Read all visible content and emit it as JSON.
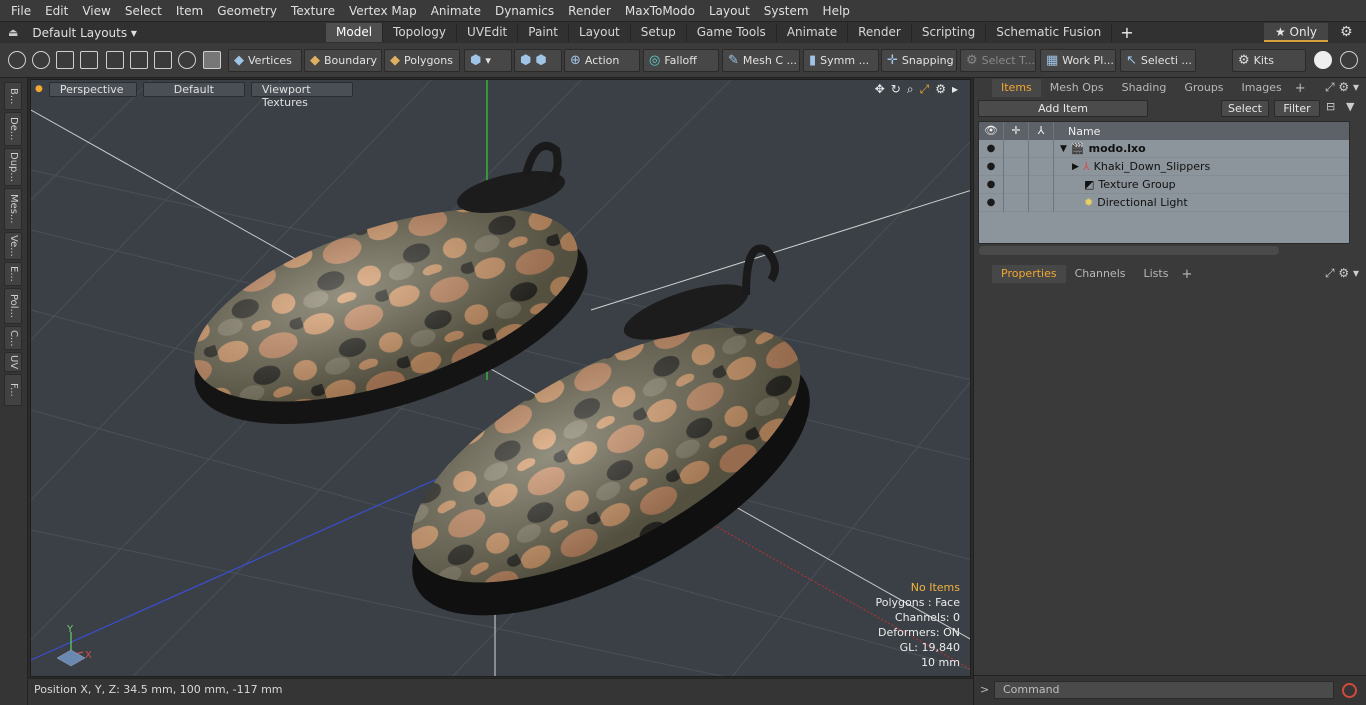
{
  "menu": [
    "File",
    "Edit",
    "View",
    "Select",
    "Item",
    "Geometry",
    "Texture",
    "Vertex Map",
    "Animate",
    "Dynamics",
    "Render",
    "MaxToModo",
    "Layout",
    "System",
    "Help"
  ],
  "layout": {
    "preset": "Default Layouts ▾",
    "tabs": [
      "Model",
      "Topology",
      "UVEdit",
      "Paint",
      "Layout",
      "Setup",
      "Game Tools",
      "Animate",
      "Render",
      "Scripting",
      "Schematic Fusion"
    ],
    "active_tab": "Model",
    "only_label": "★ Only"
  },
  "toolbar": {
    "vertices": "Vertices",
    "boundary": "Boundary",
    "polygons": "Polygons",
    "action": "Action",
    "falloff": "Falloff",
    "mesh_c": "Mesh C ...",
    "symm": "Symm ...",
    "snapping": "Snapping",
    "select_t": "Select T...",
    "work_pl": "Work Pl...",
    "selecti": "Selecti ...",
    "kits": "Kits"
  },
  "left_strip": [
    "B...",
    "De...",
    "Dup...",
    "Mes...",
    "Ve...",
    "E...",
    "Pol...",
    "C...",
    "UV",
    "F..."
  ],
  "viewport": {
    "view_mode": "Perspective",
    "style": "Default",
    "textures": "Viewport Textures",
    "stats": {
      "items": "No Items",
      "polygons": "Polygons : Face",
      "channels": "Channels: 0",
      "deformers": "Deformers: ON",
      "gl": "GL: 19,840",
      "unit": "10 mm"
    },
    "axis_x": "X",
    "axis_y": "Y"
  },
  "status": {
    "position": "Position X, Y, Z:   34.5 mm, 100 mm, -117 mm"
  },
  "items_panel": {
    "tabs": [
      "Items",
      "Mesh Ops",
      "Shading",
      "Groups",
      "Images"
    ],
    "active_tab": "Items",
    "add_item": "Add Item",
    "select": "Select",
    "filter": "Filter",
    "column_name": "Name",
    "rows": [
      {
        "name": "modo.lxo",
        "bold": true
      },
      {
        "name": "Khaki_Down_Slippers",
        "bold": false
      },
      {
        "name": "Texture Group",
        "bold": false
      },
      {
        "name": "Directional Light",
        "bold": false
      }
    ]
  },
  "properties_panel": {
    "tabs": [
      "Properties",
      "Channels",
      "Lists"
    ],
    "active_tab": "Properties"
  },
  "command": {
    "placeholder": "Command"
  },
  "colors": {
    "accent_orange": "#f0a830",
    "grid_bg": "#3a4046",
    "camo_tan": "#d79c6c",
    "camo_olive": "#6e6a52",
    "camo_dark": "#2e2e28"
  }
}
